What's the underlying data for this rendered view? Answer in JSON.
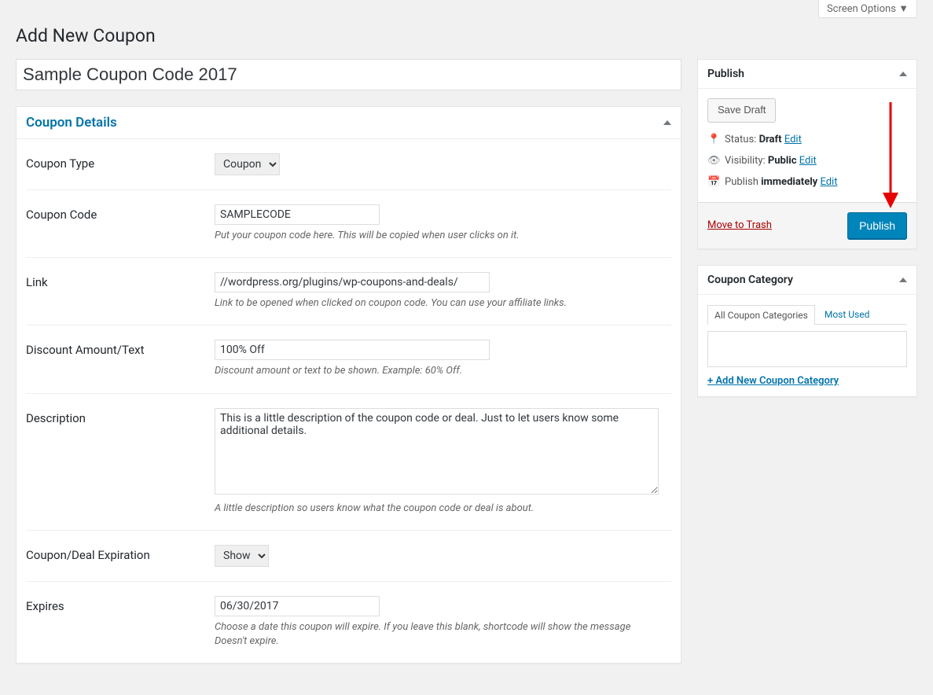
{
  "screen_options_label": "Screen Options ▼",
  "page_title": "Add New Coupon",
  "post_title": "Sample Coupon Code 2017",
  "details": {
    "title": "Coupon Details",
    "rows": {
      "coupon_type": {
        "label": "Coupon Type",
        "value": "Coupon"
      },
      "coupon_code": {
        "label": "Coupon Code",
        "value": "SAMPLECODE",
        "help": "Put your coupon code here. This will be copied when user clicks on it."
      },
      "link": {
        "label": "Link",
        "value": "//wordpress.org/plugins/wp-coupons-and-deals/",
        "help": "Link to be opened when clicked on coupon code. You can use your affiliate links."
      },
      "discount": {
        "label": "Discount Amount/Text",
        "value": "100% Off",
        "help": "Discount amount or text to be shown. Example: 60% Off."
      },
      "description": {
        "label": "Description",
        "value": "This is a little description of the coupon code or deal. Just to let users know some additional details.",
        "help": "A little description so users know what the coupon code or deal is about."
      },
      "expiration": {
        "label": "Coupon/Deal Expiration",
        "value": "Show"
      },
      "expires": {
        "label": "Expires",
        "value": "06/30/2017",
        "help": "Choose a date this coupon will expire. If you leave this blank, shortcode will show the message Doesn't expire."
      }
    }
  },
  "publish": {
    "title": "Publish",
    "save_draft": "Save Draft",
    "status_label": "Status:",
    "status_value": "Draft",
    "visibility_label": "Visibility:",
    "visibility_value": "Public",
    "schedule_prefix": "Publish",
    "schedule_value": "immediately",
    "edit": "Edit",
    "trash": "Move to Trash",
    "publish_button": "Publish"
  },
  "category": {
    "title": "Coupon Category",
    "tab_all": "All Coupon Categories",
    "tab_most": "Most Used",
    "add_new": "+ Add New Coupon Category"
  }
}
